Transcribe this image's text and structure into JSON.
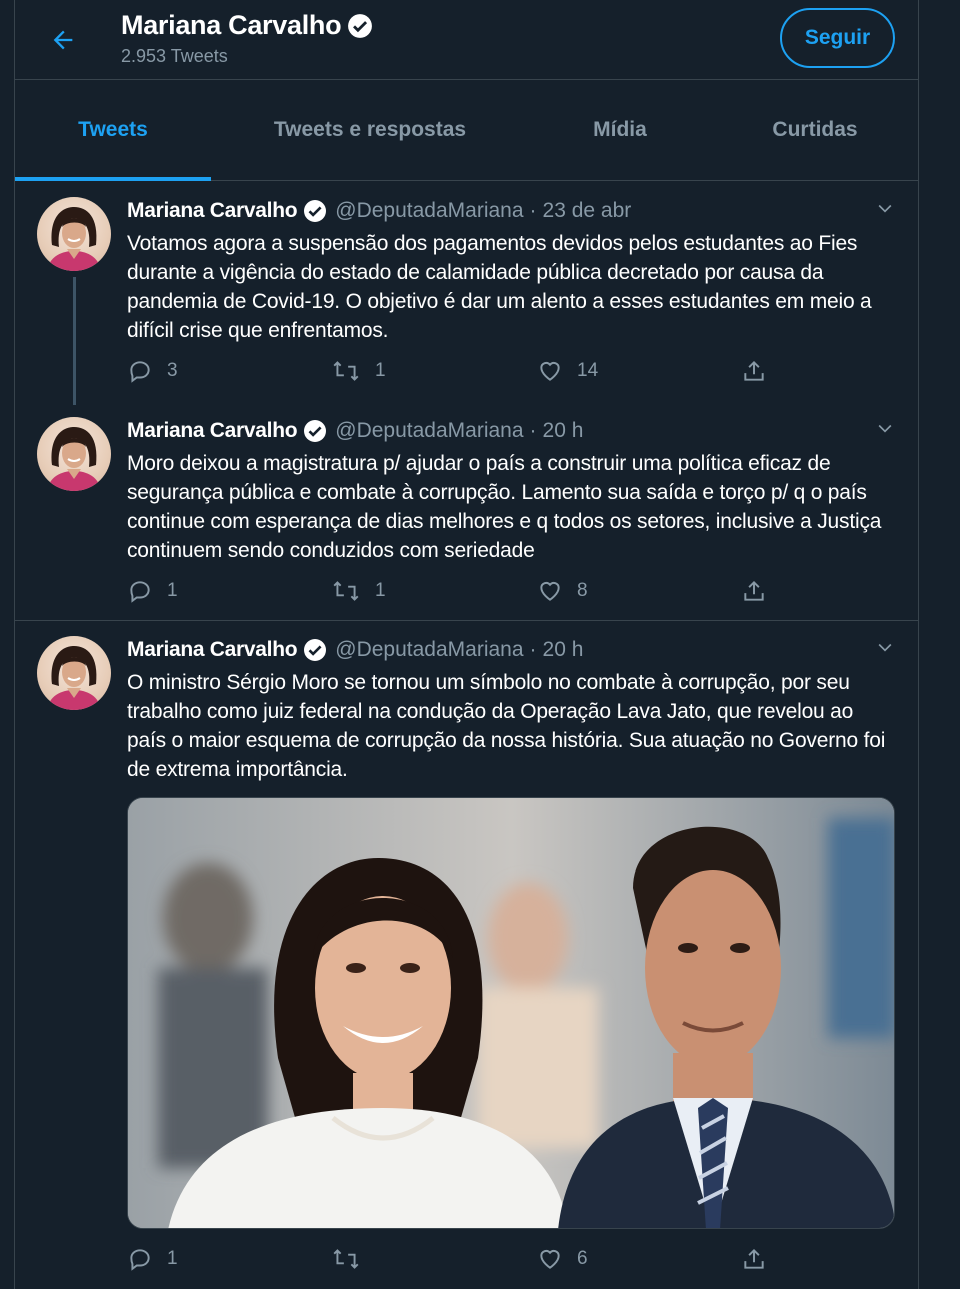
{
  "header": {
    "name": "Mariana Carvalho",
    "tweet_count": "2.953 Tweets",
    "follow_label": "Seguir"
  },
  "tabs": [
    {
      "label": "Tweets",
      "active": true
    },
    {
      "label": "Tweets e respostas",
      "active": false
    },
    {
      "label": "Mídia",
      "active": false
    },
    {
      "label": "Curtidas",
      "active": false
    }
  ],
  "tweets": [
    {
      "name": "Mariana Carvalho",
      "handle": "@DeputadaMariana",
      "separator": "·",
      "time": "23 de abr",
      "text": "Votamos agora a suspensão dos pagamentos devidos pelos estudantes ao Fies durante a vigência do estado de calamidade pública decretado por causa da pandemia de Covid-19. O objetivo é dar um alento a esses estudantes em meio a difícil crise que enfrentamos.",
      "replies": "3",
      "retweets": "1",
      "likes": "14"
    },
    {
      "name": "Mariana Carvalho",
      "handle": "@DeputadaMariana",
      "separator": "·",
      "time": "20 h",
      "text": "Moro deixou a magistratura p/ ajudar o país a construir uma política eficaz de segurança pública e combate à corrupção. Lamento sua saída e torço p/ q o país continue com esperança de dias melhores e q todos os setores, inclusive a Justiça continuem sendo conduzidos com seriedade",
      "replies": "1",
      "retweets": "1",
      "likes": "8"
    },
    {
      "name": "Mariana Carvalho",
      "handle": "@DeputadaMariana",
      "separator": "·",
      "time": "20 h",
      "text": "O ministro Sérgio Moro se tornou um símbolo no combate à corrupção, por seu trabalho como juiz federal na condução da Operação Lava Jato, que revelou ao país o maior esquema de corrupção da nossa história. Sua atuação no Governo foi de extrema importância.",
      "replies": "1",
      "retweets": "",
      "likes": "6"
    }
  ],
  "icons": {
    "back": "arrow-left-icon",
    "verified": "verified-badge-icon",
    "caret": "chevron-down-icon",
    "reply": "reply-icon",
    "retweet": "retweet-icon",
    "like": "heart-icon",
    "share": "share-icon"
  },
  "colors": {
    "background": "#15202b",
    "accent": "#1da1f2",
    "muted": "#8899a6",
    "border": "#38444d"
  }
}
